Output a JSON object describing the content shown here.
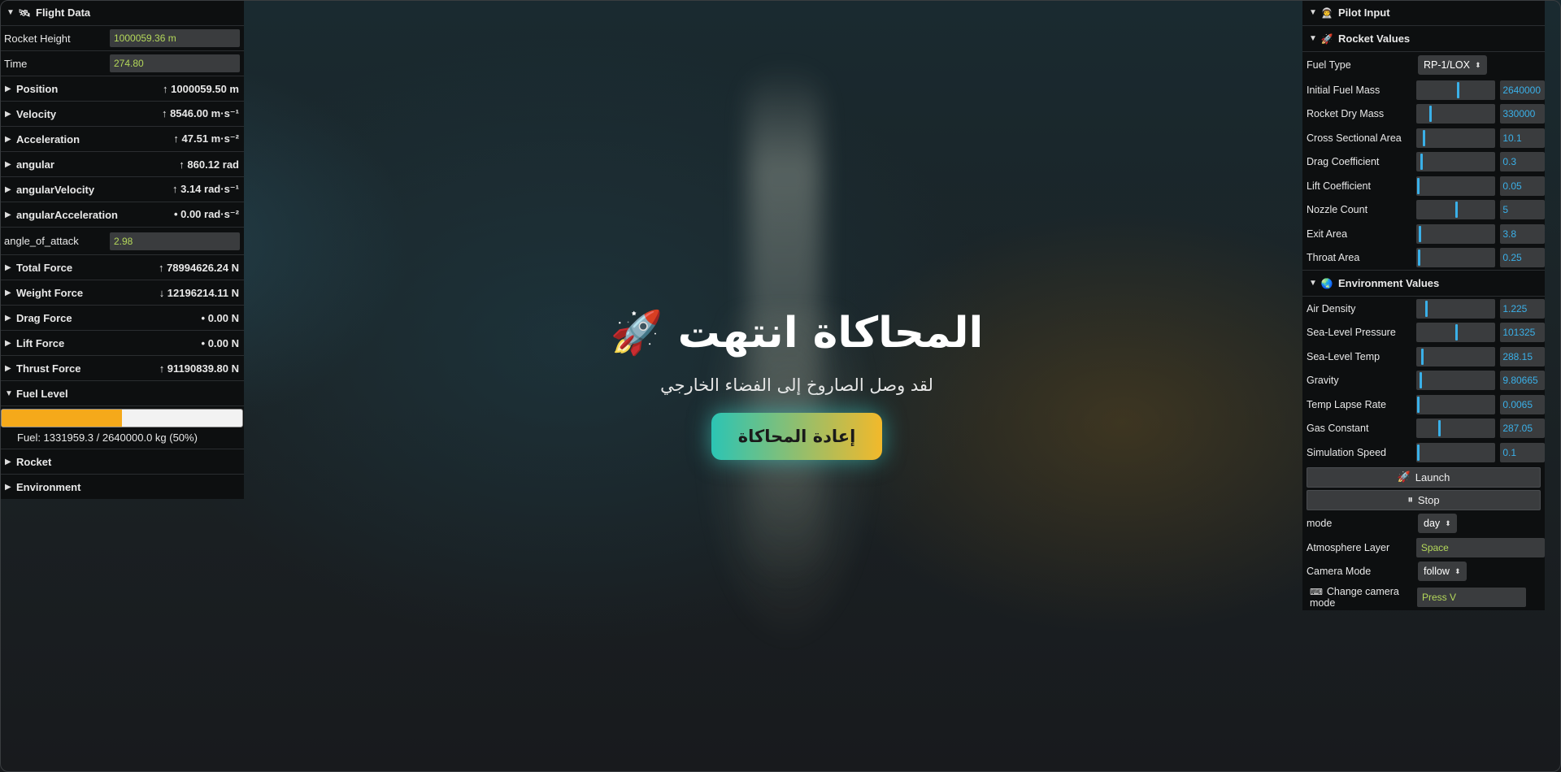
{
  "left_panel": {
    "title": "Flight Data",
    "title_icon": "satellite-icon",
    "rocket_height": {
      "label": "Rocket Height",
      "value": "1000059.36 m"
    },
    "time": {
      "label": "Time",
      "value": "274.80"
    },
    "groups": [
      {
        "name": "Position",
        "value": "↑ 1000059.50 m"
      },
      {
        "name": "Velocity",
        "value": "↑ 8546.00 m·s⁻¹"
      },
      {
        "name": "Acceleration",
        "value": "↑ 47.51 m·s⁻²"
      },
      {
        "name": "angular",
        "value": "↑ 860.12 rad"
      },
      {
        "name": "angularVelocity",
        "value": "↑ 3.14 rad·s⁻¹"
      },
      {
        "name": "angularAcceleration",
        "value": "• 0.00 rad·s⁻²"
      }
    ],
    "angle_of_attack": {
      "label": "angle_of_attack",
      "value": "2.98"
    },
    "forces": [
      {
        "name": "Total Force",
        "value": "↑ 78994626.24 N"
      },
      {
        "name": "Weight Force",
        "value": "↓ 12196214.11 N"
      },
      {
        "name": "Drag Force",
        "value": "• 0.00 N"
      },
      {
        "name": "Lift Force",
        "value": "• 0.00 N"
      },
      {
        "name": "Thrust Force",
        "value": "↑ 91190839.80 N"
      }
    ],
    "fuel_level": {
      "title": "Fuel Level",
      "fraction": 0.5,
      "text": "Fuel: 1331959.3 / 2640000.0 kg (50%)"
    },
    "rocket_group": "Rocket",
    "environment_group": "Environment"
  },
  "right_panel": {
    "title": "Pilot Input",
    "title_icon": "pilot-icon",
    "rocket_values": {
      "title": "Rocket Values",
      "icon": "rocket-icon",
      "fuel_type": {
        "label": "Fuel Type",
        "value": "RP-1/LOX"
      },
      "params": [
        {
          "label": "Initial Fuel Mass",
          "value": "2640000",
          "level": 0.52
        },
        {
          "label": "Rocket Dry Mass",
          "value": "330000",
          "level": 0.17
        },
        {
          "label": "Cross Sectional Area",
          "value": "10.1",
          "level": 0.08
        },
        {
          "label": "Drag Coefficient",
          "value": "0.3",
          "level": 0.05
        },
        {
          "label": "Lift Coefficient",
          "value": "0.05",
          "level": 0.01
        },
        {
          "label": "Nozzle Count",
          "value": "5",
          "level": 0.5
        },
        {
          "label": "Exit Area",
          "value": "3.8",
          "level": 0.03
        },
        {
          "label": "Throat Area",
          "value": "0.25",
          "level": 0.02
        }
      ]
    },
    "environment_values": {
      "title": "Environment Values",
      "icon": "globe-icon",
      "params": [
        {
          "label": "Air Density",
          "value": "1.225",
          "level": 0.12
        },
        {
          "label": "Sea-Level Pressure",
          "value": "101325",
          "level": 0.5
        },
        {
          "label": "Sea-Level Temp",
          "value": "288.15",
          "level": 0.06
        },
        {
          "label": "Gravity",
          "value": "9.80665",
          "level": 0.04
        },
        {
          "label": "Temp Lapse Rate",
          "value": "0.0065",
          "level": 0.01
        },
        {
          "label": "Gas Constant",
          "value": "287.05",
          "level": 0.28
        },
        {
          "label": "Simulation Speed",
          "value": "0.1",
          "level": 0.01
        }
      ]
    },
    "launch_button": "Launch",
    "launch_icon": "rocket-icon",
    "stop_button": "Stop",
    "stop_icon": "pause-icon",
    "mode": {
      "label": "mode",
      "value": "day"
    },
    "atmosphere_layer": {
      "label": "Atmosphere Layer",
      "value": "Space"
    },
    "camera_mode": {
      "label": "Camera Mode",
      "value": "follow"
    },
    "change_camera": {
      "label": "Change camera mode",
      "value": "Press V",
      "icon": "keyboard-icon"
    }
  },
  "overlay": {
    "title": "المحاكاة انتهت",
    "title_icon": "rocket-icon",
    "subtitle": "لقد وصل الصاروخ إلى الفضاء الخارجي",
    "restart_button": "إعادة المحاكاة"
  },
  "colors": {
    "accent": "#3ab0e8",
    "value_text": "#b4d85a",
    "fuel_fill": "#f5a91a"
  }
}
